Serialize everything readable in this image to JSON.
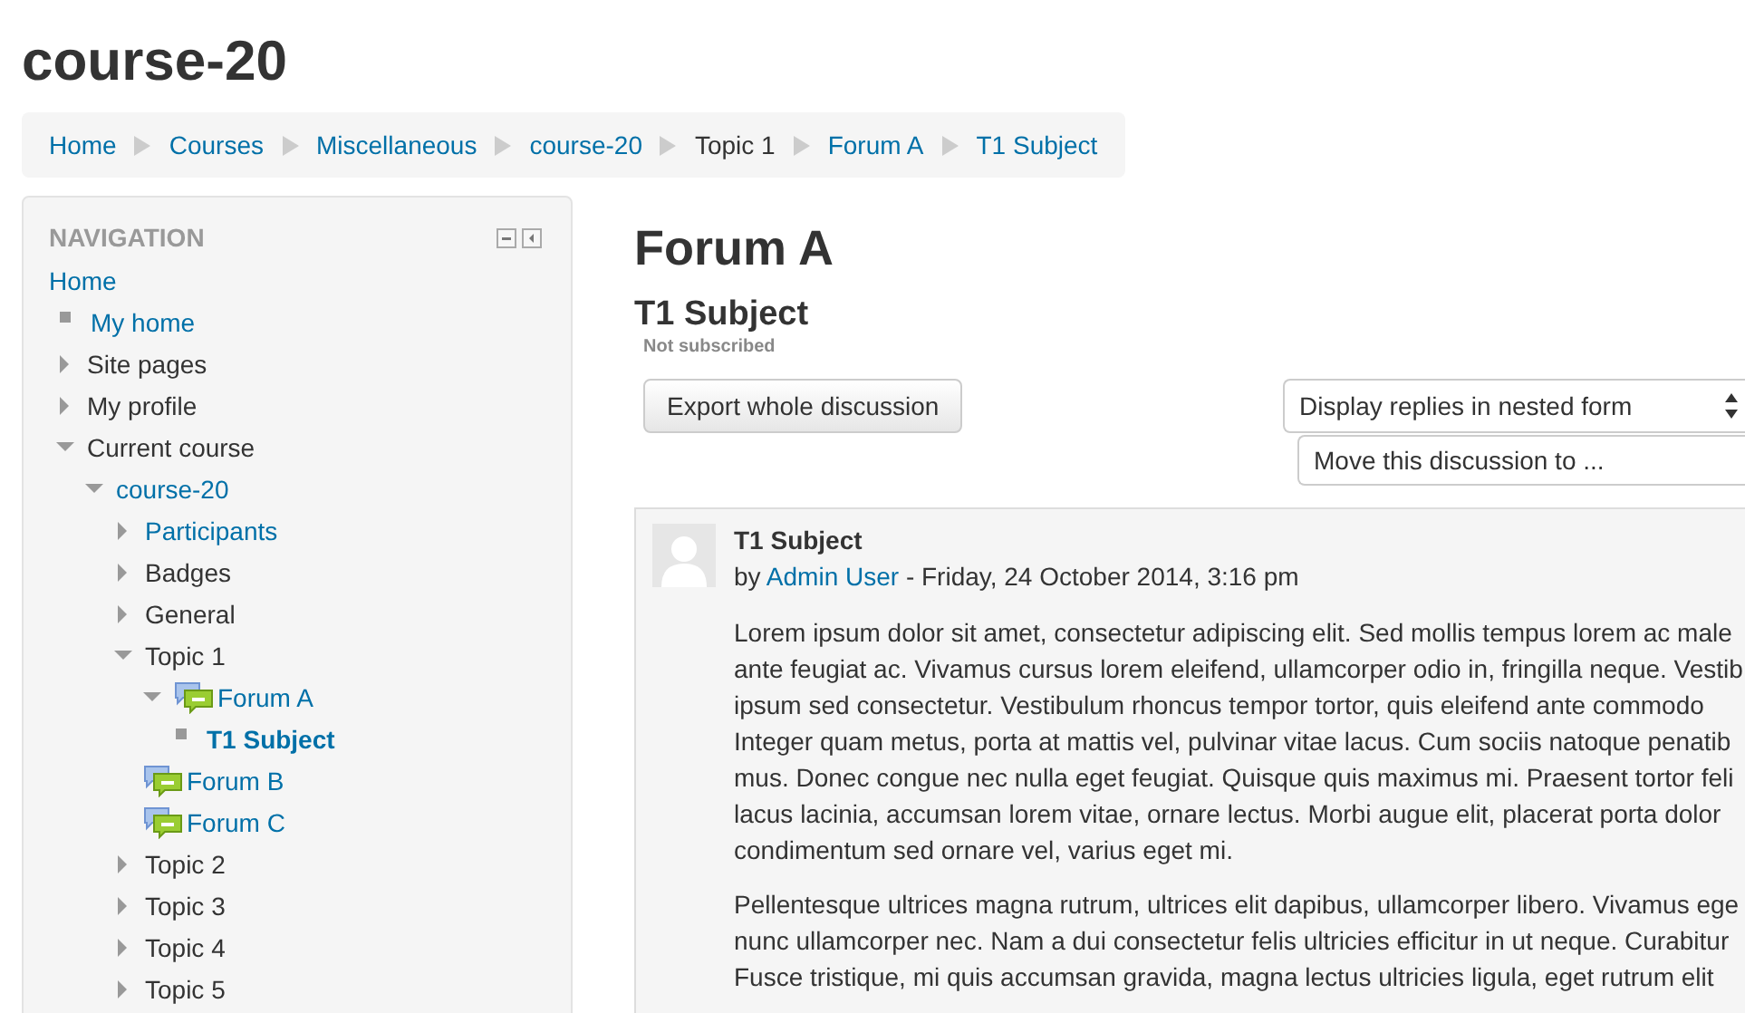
{
  "page_title": "course-20",
  "breadcrumb": [
    {
      "label": "Home",
      "link": true
    },
    {
      "label": "Courses",
      "link": true
    },
    {
      "label": "Miscellaneous",
      "link": true
    },
    {
      "label": "course-20",
      "link": true
    },
    {
      "label": "Topic 1",
      "link": false
    },
    {
      "label": "Forum A",
      "link": true
    },
    {
      "label": "T1 Subject",
      "link": true
    }
  ],
  "navigation": {
    "title": "NAVIGATION",
    "tree": [
      {
        "label": "Home",
        "link": true,
        "children": [
          {
            "label": "My home",
            "kind": "leaf",
            "link": true
          },
          {
            "label": "Site pages",
            "kind": "branch",
            "expanded": false,
            "link": false
          },
          {
            "label": "My profile",
            "kind": "branch",
            "expanded": false,
            "link": false
          },
          {
            "label": "Current course",
            "kind": "branch",
            "expanded": true,
            "link": false,
            "children": [
              {
                "label": "course-20",
                "kind": "branch",
                "expanded": true,
                "link": true,
                "children": [
                  {
                    "label": "Participants",
                    "kind": "branch",
                    "expanded": false,
                    "link": true
                  },
                  {
                    "label": "Badges",
                    "kind": "branch",
                    "expanded": false,
                    "link": false
                  },
                  {
                    "label": "General",
                    "kind": "branch",
                    "expanded": false,
                    "link": false
                  },
                  {
                    "label": "Topic 1",
                    "kind": "branch",
                    "expanded": true,
                    "link": false,
                    "children": [
                      {
                        "label": "Forum A",
                        "kind": "branch",
                        "expanded": true,
                        "forum": true,
                        "link": true,
                        "children": [
                          {
                            "label": "T1 Subject",
                            "kind": "leaf",
                            "link": true,
                            "current": true
                          }
                        ]
                      },
                      {
                        "label": "Forum B",
                        "forum": true,
                        "link": true
                      },
                      {
                        "label": "Forum C",
                        "forum": true,
                        "link": true
                      }
                    ]
                  },
                  {
                    "label": "Topic 2",
                    "kind": "branch",
                    "expanded": false,
                    "link": false
                  },
                  {
                    "label": "Topic 3",
                    "kind": "branch",
                    "expanded": false,
                    "link": false
                  },
                  {
                    "label": "Topic 4",
                    "kind": "branch",
                    "expanded": false,
                    "link": false
                  },
                  {
                    "label": "Topic 5",
                    "kind": "branch",
                    "expanded": false,
                    "link": false
                  }
                ]
              }
            ]
          }
        ]
      }
    ]
  },
  "forum": {
    "title": "Forum A",
    "discussion_title": "T1 Subject",
    "subscription": "Not subscribed",
    "export_button": "Export whole discussion",
    "display_select": "Display replies in nested form",
    "move_select": "Move this discussion to ..."
  },
  "post": {
    "subject": "T1 Subject",
    "by": "by",
    "author": "Admin User",
    "date": "- Friday, 24 October 2014, 3:16 pm",
    "paragraphs": [
      [
        "Lorem ipsum dolor sit amet, consectetur adipiscing elit. Sed mollis tempus lorem ac male",
        "ante feugiat ac. Vivamus cursus lorem eleifend, ullamcorper odio in, fringilla neque. Vestib",
        "ipsum sed consectetur. Vestibulum rhoncus tempor tortor, quis eleifend ante commodo",
        "Integer quam metus, porta at mattis vel, pulvinar vitae lacus. Cum sociis natoque penatib",
        "mus. Donec congue nec nulla eget feugiat. Quisque quis maximus mi. Praesent tortor feli",
        "lacus lacinia, accumsan lorem vitae, ornare lectus. Morbi augue elit, placerat porta dolor",
        "condimentum sed ornare vel, varius eget mi."
      ],
      [
        "Pellentesque ultrices magna rutrum, ultrices elit dapibus, ullamcorper libero. Vivamus ege",
        "nunc ullamcorper nec. Nam a dui consectetur felis ultricies efficitur in ut neque. Curabitur",
        "Fusce tristique, mi quis accumsan gravida, magna lectus ultricies ligula, eget rutrum elit"
      ]
    ]
  }
}
